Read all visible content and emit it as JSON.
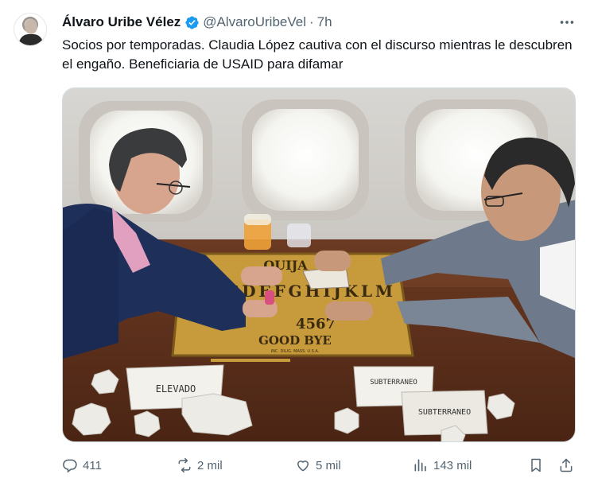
{
  "author": {
    "name": "Álvaro Uribe Vélez",
    "handle": "@AlvaroUribeVel",
    "separator": "·",
    "time": "7h",
    "verified": true,
    "verified_color": "#1d9bf0"
  },
  "tweet": {
    "text": "Socios por temporadas. Claudia López cautiva con el discurso mientras le descubren el engaño. Beneficiaria de USAID para difamar"
  },
  "media": {
    "icon": "photo",
    "board_top": "QUIJA",
    "board_letters_1": "ABCDEFGHIJKLM",
    "board_digits": "4567",
    "board_footer": "GOOD BYE",
    "board_maker": "INC. DILIG. MASS. U.S.A.",
    "paper_left": "ELEVADO",
    "paper_right_1": "SUBTERRANEO",
    "paper_right_2": "SUBTERRANEO"
  },
  "actions": {
    "replies": "411",
    "retweets": "2 mil",
    "likes": "5 mil",
    "views": "143 mil",
    "icon_color": "#536471"
  }
}
